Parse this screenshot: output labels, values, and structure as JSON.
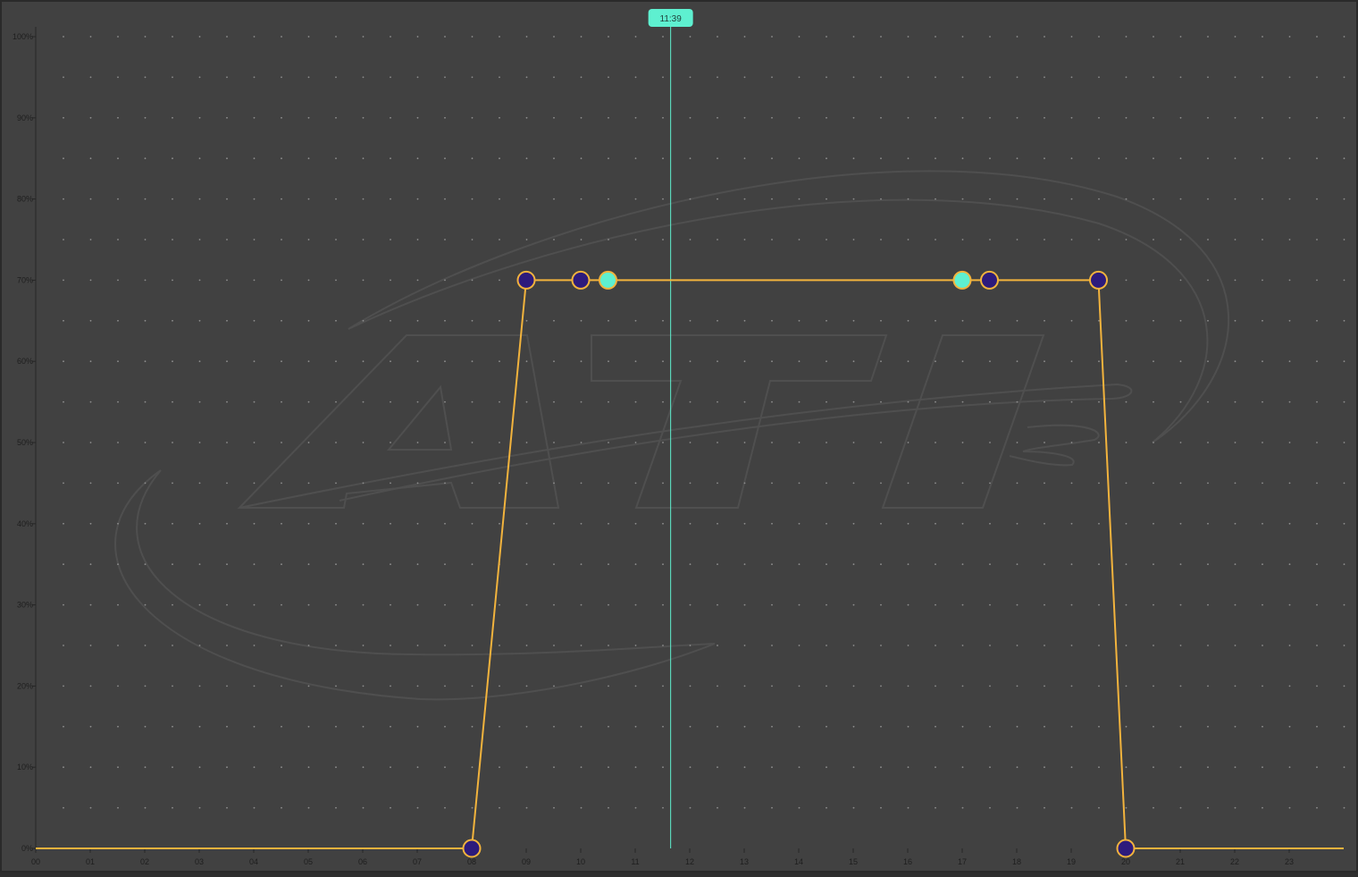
{
  "watermark": {
    "text": "ATI"
  },
  "current_time": {
    "label": "11:39",
    "value_hours": 11.65
  },
  "colors": {
    "background": "#414141",
    "border": "#2a2a2a",
    "grid_dot": "#8e8e8e",
    "axis_text": "#1e1e1e",
    "line": "#f2b33d",
    "point_fill": "#2d1b7c",
    "point_stroke": "#f2b33d",
    "highlight_fill": "#5ef0d0",
    "now_line": "#5ef0d0",
    "watermark": "#4f4f4f"
  },
  "chart_data": {
    "type": "line",
    "title": "",
    "xlabel": "",
    "ylabel": "",
    "xlim": [
      0,
      24
    ],
    "ylim": [
      0,
      100
    ],
    "x_ticks": [
      "00",
      "01",
      "02",
      "03",
      "04",
      "05",
      "06",
      "07",
      "08",
      "09",
      "10",
      "11",
      "12",
      "13",
      "14",
      "15",
      "16",
      "17",
      "18",
      "19",
      "20",
      "21",
      "22",
      "23"
    ],
    "y_ticks": [
      "0%",
      "10%",
      "20%",
      "30%",
      "40%",
      "50%",
      "60%",
      "70%",
      "80%",
      "90%",
      "100%"
    ],
    "grid": "dots",
    "series": [
      {
        "points": [
          {
            "x": 0,
            "y": 0,
            "marker": false
          },
          {
            "x": 8.0,
            "y": 0,
            "marker": true
          },
          {
            "x": 9.0,
            "y": 70,
            "marker": true
          },
          {
            "x": 10.0,
            "y": 70,
            "marker": true
          },
          {
            "x": 10.5,
            "y": 70,
            "marker": true,
            "highlight": true
          },
          {
            "x": 17.0,
            "y": 70,
            "marker": true,
            "highlight": true
          },
          {
            "x": 17.5,
            "y": 70,
            "marker": true
          },
          {
            "x": 19.5,
            "y": 70,
            "marker": true
          },
          {
            "x": 20.0,
            "y": 0,
            "marker": true
          },
          {
            "x": 24,
            "y": 0,
            "marker": false
          }
        ]
      }
    ]
  }
}
